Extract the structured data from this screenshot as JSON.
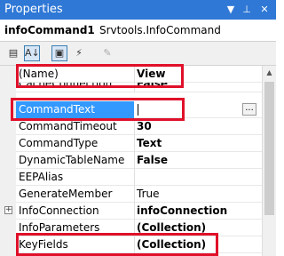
{
  "window": {
    "title": "Properties"
  },
  "object": {
    "name": "infoCommand1",
    "type": "Srvtools.InfoCommand"
  },
  "toolbar": {
    "categorized": "categorized-icon",
    "alphabetical": "alphabetical-icon",
    "properties": "properties-icon",
    "events": "events-icon",
    "property_pages": "property-pages-icon"
  },
  "properties": [
    {
      "name": "(Name)",
      "value": "View",
      "bold": true
    },
    {
      "name": "CacheConnection",
      "value": "False",
      "bold": true
    },
    {
      "name": "CommandText",
      "value": "",
      "bold": false,
      "selected": true,
      "ellipsis": "..."
    },
    {
      "name": "CommandTimeout",
      "value": "30",
      "bold": true
    },
    {
      "name": "CommandType",
      "value": "Text",
      "bold": true
    },
    {
      "name": "DynamicTableName",
      "value": "False",
      "bold": true
    },
    {
      "name": "EEPAlias",
      "value": "",
      "bold": false
    },
    {
      "name": "GenerateMember",
      "value": "True",
      "bold": false
    },
    {
      "name": "InfoConnection",
      "value": "infoConnection",
      "bold": true,
      "expandable": true,
      "expander": "+"
    },
    {
      "name": "InfoParameters",
      "value": "(Collection)",
      "bold": true
    },
    {
      "name": "KeyFields",
      "value": "(Collection)",
      "bold": true
    }
  ],
  "highlight_color": "#e0102a",
  "accent_color": "#3399ff"
}
